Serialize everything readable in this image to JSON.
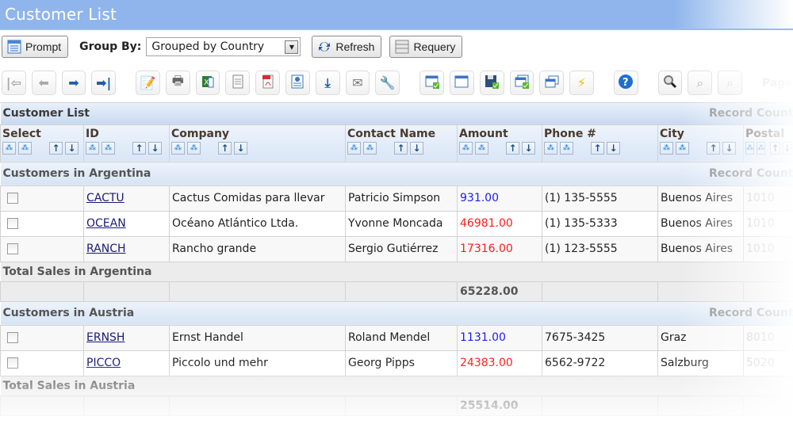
{
  "header": {
    "title": "Customer List"
  },
  "controls": {
    "prompt_label": "Prompt",
    "group_by_label": "Group By:",
    "group_by_value": "Grouped by Country",
    "refresh_label": "Refresh",
    "requery_label": "Requery"
  },
  "toolbar": {
    "icons": [
      "first-page-icon",
      "previous-page-icon",
      "next-page-icon",
      "last-page-icon",
      "edit-icon",
      "print-icon",
      "excel-export-icon",
      "text-export-icon",
      "pdf-export-icon",
      "html-export-icon",
      "download-icon",
      "email-icon",
      "settings-wrench-icon",
      "save-layout-icon",
      "window-icon",
      "save-icon",
      "windows-check-icon",
      "windows-icon",
      "lightning-icon",
      "help-icon",
      "search-icon",
      "search-previous-icon",
      "search-next-icon"
    ],
    "page_label": "Page"
  },
  "grid": {
    "caption": "Customer List",
    "record_count_label": "Record Count",
    "columns": [
      "Select",
      "ID",
      "Company",
      "Contact Name",
      "Amount",
      "Phone #",
      "City",
      "Postal"
    ],
    "groups": [
      {
        "title": "Customers in Argentina",
        "record_count_label": "Record Count",
        "rows": [
          {
            "id": "CACTU",
            "company": "Cactus Comidas para llevar",
            "contact": "Patricio Simpson",
            "amount": "931.00",
            "amount_color": "blue",
            "phone": "(1) 135-5555",
            "city": "Buenos Aires",
            "postal": "1010"
          },
          {
            "id": "OCEAN",
            "company": "Océano Atlántico Ltda.",
            "contact": "Yvonne Moncada",
            "amount": "46981.00",
            "amount_color": "red",
            "phone": "(1) 135-5333",
            "city": "Buenos Aires",
            "postal": "1010"
          },
          {
            "id": "RANCH",
            "company": "Rancho grande",
            "contact": "Sergio Gutiérrez",
            "amount": "17316.00",
            "amount_color": "red",
            "phone": "(1) 123-5555",
            "city": "Buenos Aires",
            "postal": "1010"
          }
        ],
        "total_label": "Total Sales in Argentina",
        "total_amount": "65228.00"
      },
      {
        "title": "Customers in Austria",
        "record_count_label": "Record Count",
        "rows": [
          {
            "id": "ERNSH",
            "company": "Ernst Handel",
            "contact": "Roland Mendel",
            "amount": "1131.00",
            "amount_color": "blue",
            "phone": "7675-3425",
            "city": "Graz",
            "postal": "8010"
          },
          {
            "id": "PICCO",
            "company": "Piccolo und mehr",
            "contact": "Georg Pipps",
            "amount": "24383.00",
            "amount_color": "red",
            "phone": "6562-9722",
            "city": "Salzburg",
            "postal": "5020"
          }
        ],
        "total_label": "Total Sales in Austria",
        "total_amount": "25514.00"
      }
    ]
  },
  "colors": {
    "title_bar": "#8fb5ec",
    "amount_positive": "#1a1aff",
    "amount_high": "#ff1a1a"
  }
}
